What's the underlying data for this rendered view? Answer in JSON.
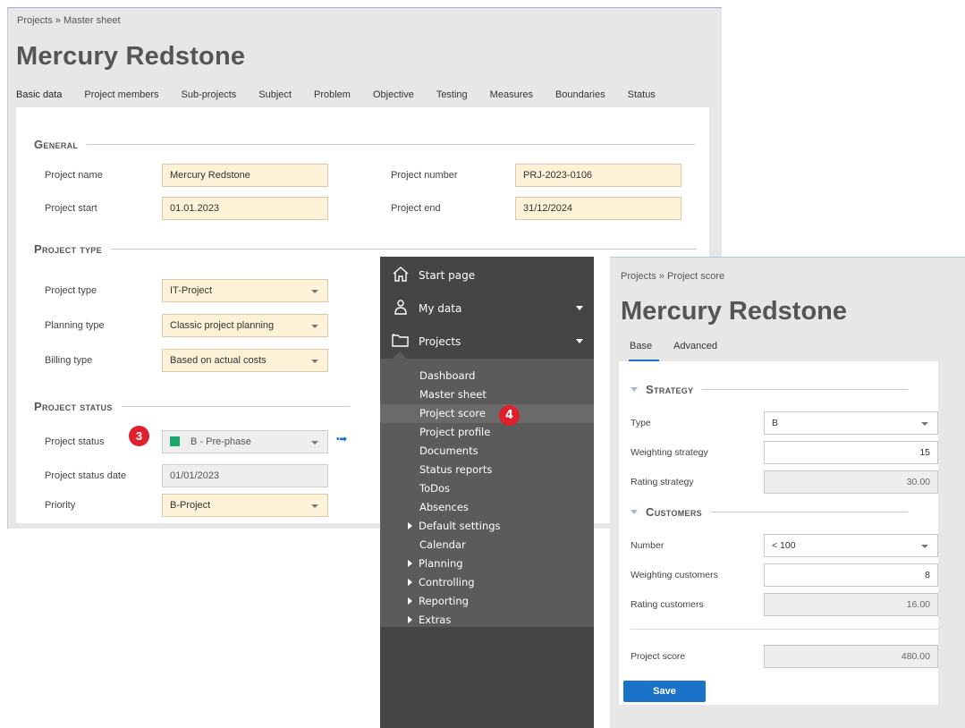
{
  "master": {
    "breadcrumb": "Projects » Master sheet",
    "title": "Mercury Redstone",
    "tabs": [
      "Basic data",
      "Project members",
      "Sub-projects",
      "Subject",
      "Problem",
      "Objective",
      "Testing",
      "Measures",
      "Boundaries",
      "Status"
    ],
    "active_tab": "Basic data",
    "general": {
      "heading": "General",
      "project_name_label": "Project name",
      "project_name": "Mercury Redstone",
      "project_number_label": "Project number",
      "project_number": "PRJ-2023-0106",
      "project_start_label": "Project start",
      "project_start": "01.01.2023",
      "project_end_label": "Project end",
      "project_end": "31/12/2024"
    },
    "project_type": {
      "heading": "Project type",
      "project_type_label": "Project type",
      "project_type": "IT-Project",
      "planning_type_label": "Planning type",
      "planning_type": "Classic project planning",
      "billing_type_label": "Billing type",
      "billing_type": "Based on actual costs"
    },
    "project_status": {
      "heading": "Project status",
      "status_label": "Project status",
      "status": "B - Pre-phase",
      "status_color": "#1aa86a",
      "status_date_label": "Project status date",
      "status_date": "01/01/2023",
      "priority_label": "Priority",
      "priority": "B-Project"
    },
    "badge": "3"
  },
  "nav": {
    "top_items": [
      {
        "label": "Start page",
        "icon": "home-icon"
      },
      {
        "label": "My data",
        "icon": "person-icon"
      },
      {
        "label": "Projects",
        "icon": "folder-icon"
      }
    ],
    "sub_items": [
      "Dashboard",
      "Master sheet",
      "Project score",
      "Project profile",
      "Documents",
      "Status reports",
      "ToDos",
      "Absences",
      "Default settings",
      "Calendar",
      "Planning",
      "Controlling",
      "Reporting",
      "Extras"
    ],
    "active_sub_item": "Project score",
    "badge": "4"
  },
  "score": {
    "breadcrumb": "Projects » Project score",
    "title": "Mercury Redstone",
    "tabs": [
      "Base",
      "Advanced"
    ],
    "active_tab": "Base",
    "strategy": {
      "heading": "Strategy",
      "type_label": "Type",
      "type": "B",
      "weighting_label": "Weighting strategy",
      "weighting": "15",
      "rating_label": "Rating strategy",
      "rating": "30.00"
    },
    "customers": {
      "heading": "Customers",
      "number_label": "Number",
      "number": "< 100",
      "weighting_label": "Weighting customers",
      "weighting": "8",
      "rating_label": "Rating customers",
      "rating": "16.00"
    },
    "project_score_label": "Project score",
    "project_score": "480.00",
    "save_label": "Save"
  }
}
